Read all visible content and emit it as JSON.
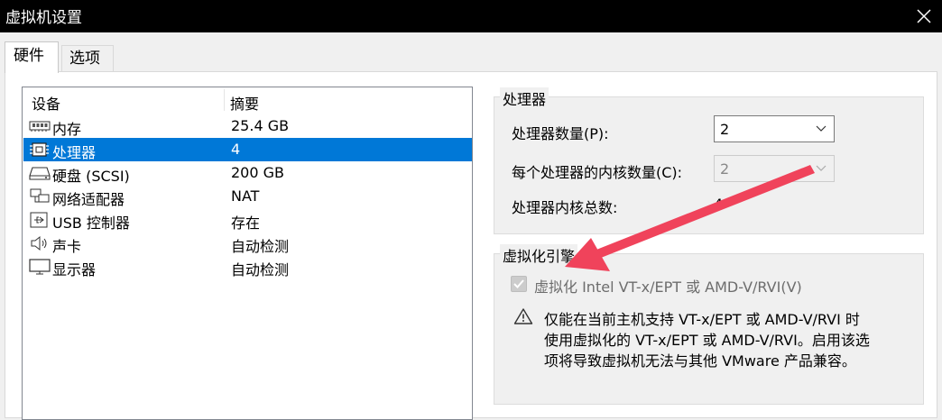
{
  "window": {
    "title": "虚拟机设置",
    "close_icon": "close-icon"
  },
  "tabs": [
    {
      "label": "硬件",
      "active": true
    },
    {
      "label": "选项",
      "active": false
    }
  ],
  "device_list": {
    "columns": {
      "device": "设备",
      "summary": "摘要"
    },
    "rows": [
      {
        "icon": "memory-icon",
        "name": "内存",
        "value": "25.4 GB",
        "selected": false
      },
      {
        "icon": "processor-icon",
        "name": "处理器",
        "value": "4",
        "selected": true
      },
      {
        "icon": "hard-disk-icon",
        "name": "硬盘 (SCSI)",
        "value": "200 GB",
        "selected": false
      },
      {
        "icon": "network-adapter-icon",
        "name": "网络适配器",
        "value": "NAT",
        "selected": false
      },
      {
        "icon": "usb-controller-icon",
        "name": "USB 控制器",
        "value": "存在",
        "selected": false
      },
      {
        "icon": "sound-card-icon",
        "name": "声卡",
        "value": "自动检测",
        "selected": false
      },
      {
        "icon": "display-icon",
        "name": "显示器",
        "value": "自动检测",
        "selected": false
      }
    ]
  },
  "processor_group": {
    "legend": "处理器",
    "num_processors_label": "处理器数量(P):",
    "num_processors_value": "2",
    "cores_per_processor_label": "每个处理器的内核数量(C):",
    "cores_per_processor_value": "2",
    "total_cores_label": "处理器内核总数:",
    "total_cores_value": "4"
  },
  "virtualization_group": {
    "legend": "虚拟化引擎",
    "checkbox_label": "虚拟化 Intel VT-x/EPT 或 AMD-V/RVI(V)",
    "checkbox_checked": true,
    "checkbox_disabled": true,
    "warning_lines": [
      "仅能在当前主机支持 VT-x/EPT 或 AMD-V/RVI 时",
      "使用虚拟化的 VT-x/EPT 或 AMD-V/RVI。启用该选",
      "项将导致虚拟机无法与其他 VMware 产品兼容。"
    ]
  },
  "colors": {
    "selection": "#0078d7",
    "annotation_arrow": "#f0435b",
    "titlebar": "#000000"
  }
}
